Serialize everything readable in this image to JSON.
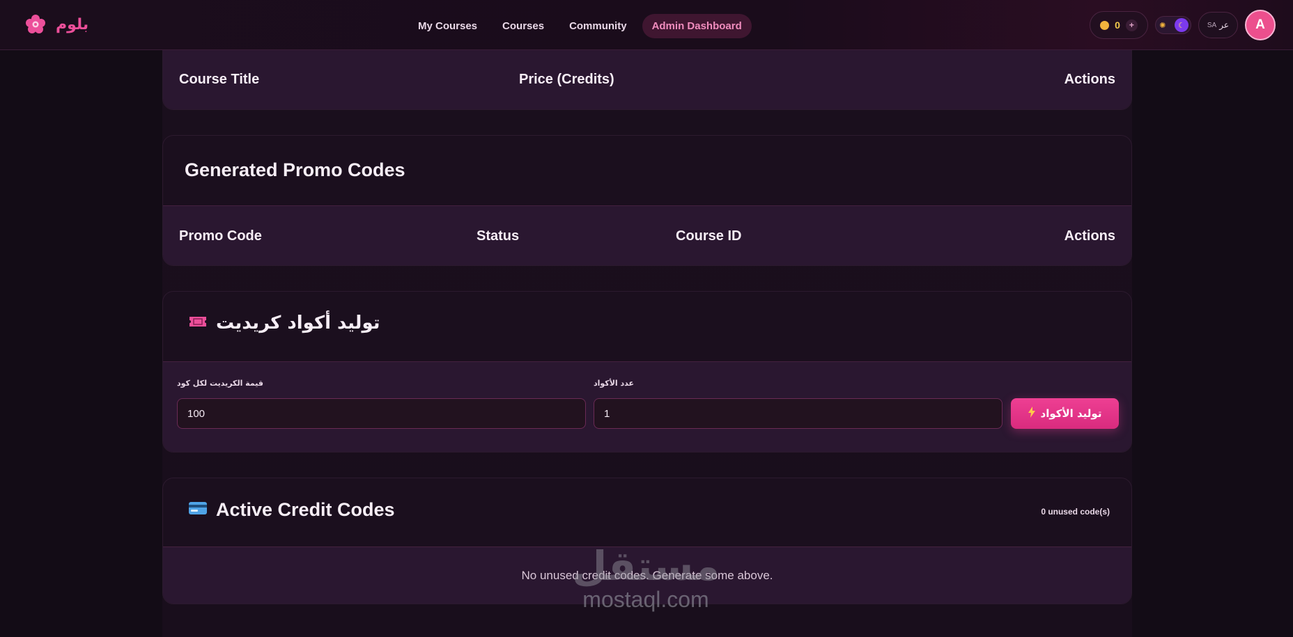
{
  "header": {
    "logo_text": "بلوم",
    "nav": [
      {
        "label": "My Courses"
      },
      {
        "label": "Courses"
      },
      {
        "label": "Community"
      },
      {
        "label": "Admin Dashboard",
        "active": true
      }
    ],
    "credits": "0",
    "language": {
      "label": "عر",
      "code": "SA"
    },
    "avatar_initial": "A"
  },
  "courses_table": {
    "columns": [
      "Course Title",
      "Price (Credits)",
      "Actions"
    ]
  },
  "promo_codes": {
    "title": "Generated Promo Codes",
    "columns": [
      "Promo Code",
      "Status",
      "Course ID",
      "Actions"
    ]
  },
  "generate_credit_codes": {
    "title": "توليد أكواد كريديت",
    "credit_value_label": "قيمة الكريديت لكل كود",
    "credit_value": "100",
    "count_label": "عدد الأكواد",
    "count_value": "1",
    "button_label": "توليد الأكواد"
  },
  "active_credit_codes": {
    "title": "Active Credit Codes",
    "unused_count": "0 unused code(s)",
    "empty_message": "No unused credit codes. Generate some above."
  },
  "watermark": {
    "arabic": "مستقل",
    "latin": "mostaql.com"
  },
  "colors": {
    "accent": "#ec4f9a",
    "background": "#130c16",
    "card": "#1b0f1e",
    "table_head": "#2a1730"
  }
}
